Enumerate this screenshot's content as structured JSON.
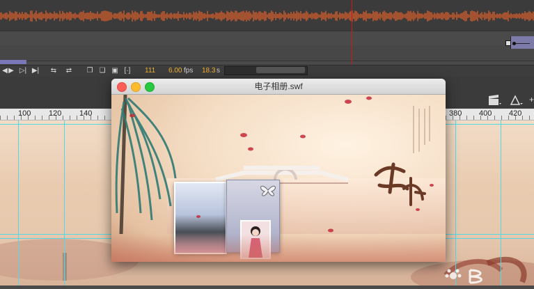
{
  "timeline": {
    "frame_number": "111",
    "fps_value": "6.00",
    "fps_unit": "fps",
    "elapsed_value": "18.3",
    "elapsed_unit": "s",
    "audio_wave_color": "#e8622a",
    "playhead_color": "#d01818"
  },
  "controls": {
    "icons": [
      "rewind-icon",
      "play-icon",
      "step-forward-icon",
      "go-to-end-icon",
      "loop-icon",
      "center-frame-icon",
      "onion-skin-icon",
      "onion-skin-outlines-icon",
      "edit-multiple-frames-icon",
      "modify-onion-markers-icon",
      "scroll-left-icon"
    ]
  },
  "ruler": {
    "labels": [
      "100",
      "120",
      "140",
      "380",
      "400",
      "420"
    ]
  },
  "swf_window": {
    "title": "电子相册.swf"
  },
  "toolbar_right": {
    "icons": [
      "clapperboard-icon",
      "pen-tool-icon",
      "plus-icon"
    ]
  },
  "colors": {
    "guide": "#52d9e6",
    "accent_orange": "#f2b02e"
  }
}
